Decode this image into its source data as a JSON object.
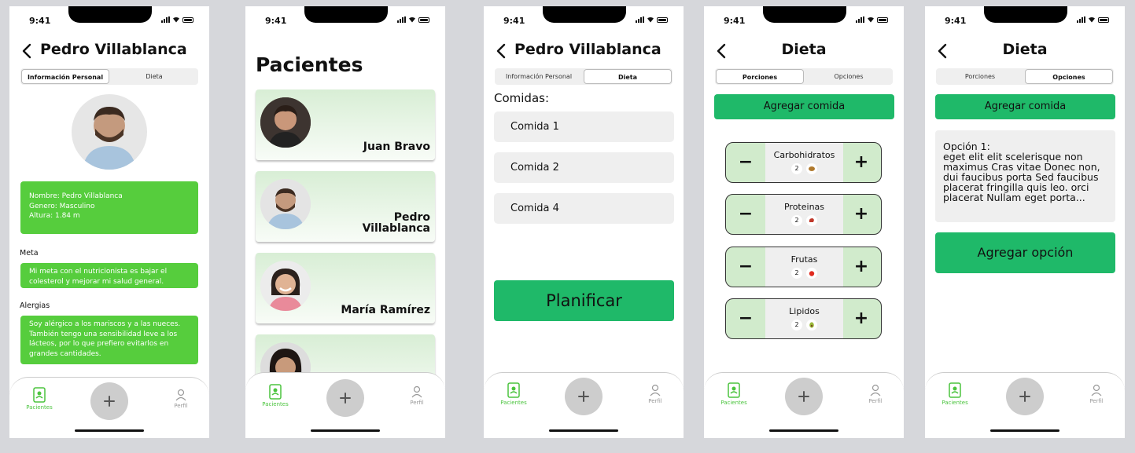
{
  "status": {
    "time": "9:41"
  },
  "nav": {
    "pacientes": "Pacientes",
    "perfil": "Perfil"
  },
  "screen1": {
    "title": "Pedro Villablanca",
    "tabs": [
      "Información Personal",
      "Dieta"
    ],
    "info": [
      "Nombre: Pedro Villablanca",
      "Genero: Masculino",
      "Altura: 1.84 m"
    ],
    "meta_label": "Meta",
    "meta_text": "Mi meta con el nutricionista es bajar el colesterol y mejorar mi salud general.",
    "alergias_label": "Alergias",
    "alergias_text": "Soy alérgico a los mariscos y a las nueces. También tengo una sensibilidad leve a los lácteos, por lo que prefiero evitarlos en grandes cantidades."
  },
  "screen2": {
    "title": "Pacientes",
    "patients": [
      {
        "name": "Juan Bravo"
      },
      {
        "name_line1": "Pedro",
        "name_line2": "Villablanca"
      },
      {
        "name": "María Ramírez"
      }
    ]
  },
  "screen3": {
    "title": "Pedro Villablanca",
    "tabs": [
      "Información Personal",
      "Dieta"
    ],
    "comidas_label": "Comidas:",
    "meals": [
      "Comida 1",
      "Comida 2",
      "Comida 4"
    ],
    "plan_button": "Planificar"
  },
  "screen4": {
    "title": "Dieta",
    "tabs": [
      "Porciones",
      "Opciones"
    ],
    "add_meal": "Agregar comida",
    "portions": [
      {
        "name": "Carbohidratos",
        "count": "2",
        "icon": "bread-icon"
      },
      {
        "name": "Proteinas",
        "count": "2",
        "icon": "meat-icon"
      },
      {
        "name": "Frutas",
        "count": "2",
        "icon": "apple-icon"
      },
      {
        "name": "Lipidos",
        "count": "2",
        "icon": "avocado-icon"
      }
    ],
    "minus": "−",
    "plus": "+"
  },
  "screen5": {
    "title": "Dieta",
    "tabs": [
      "Porciones",
      "Opciones"
    ],
    "add_meal": "Agregar comida",
    "option_title": "Opción 1:",
    "option_text": "eget elit elit scelerisque non maximus Cras vitae Donec non, dui faucibus porta Sed faucibus placerat fringilla quis leo. orci placerat Nullam eget porta...",
    "add_option": "Agregar opción"
  },
  "colors": {
    "green": "#56cd3d",
    "button_green": "#1fb969",
    "stepper_bg": "#d1ebcc"
  }
}
